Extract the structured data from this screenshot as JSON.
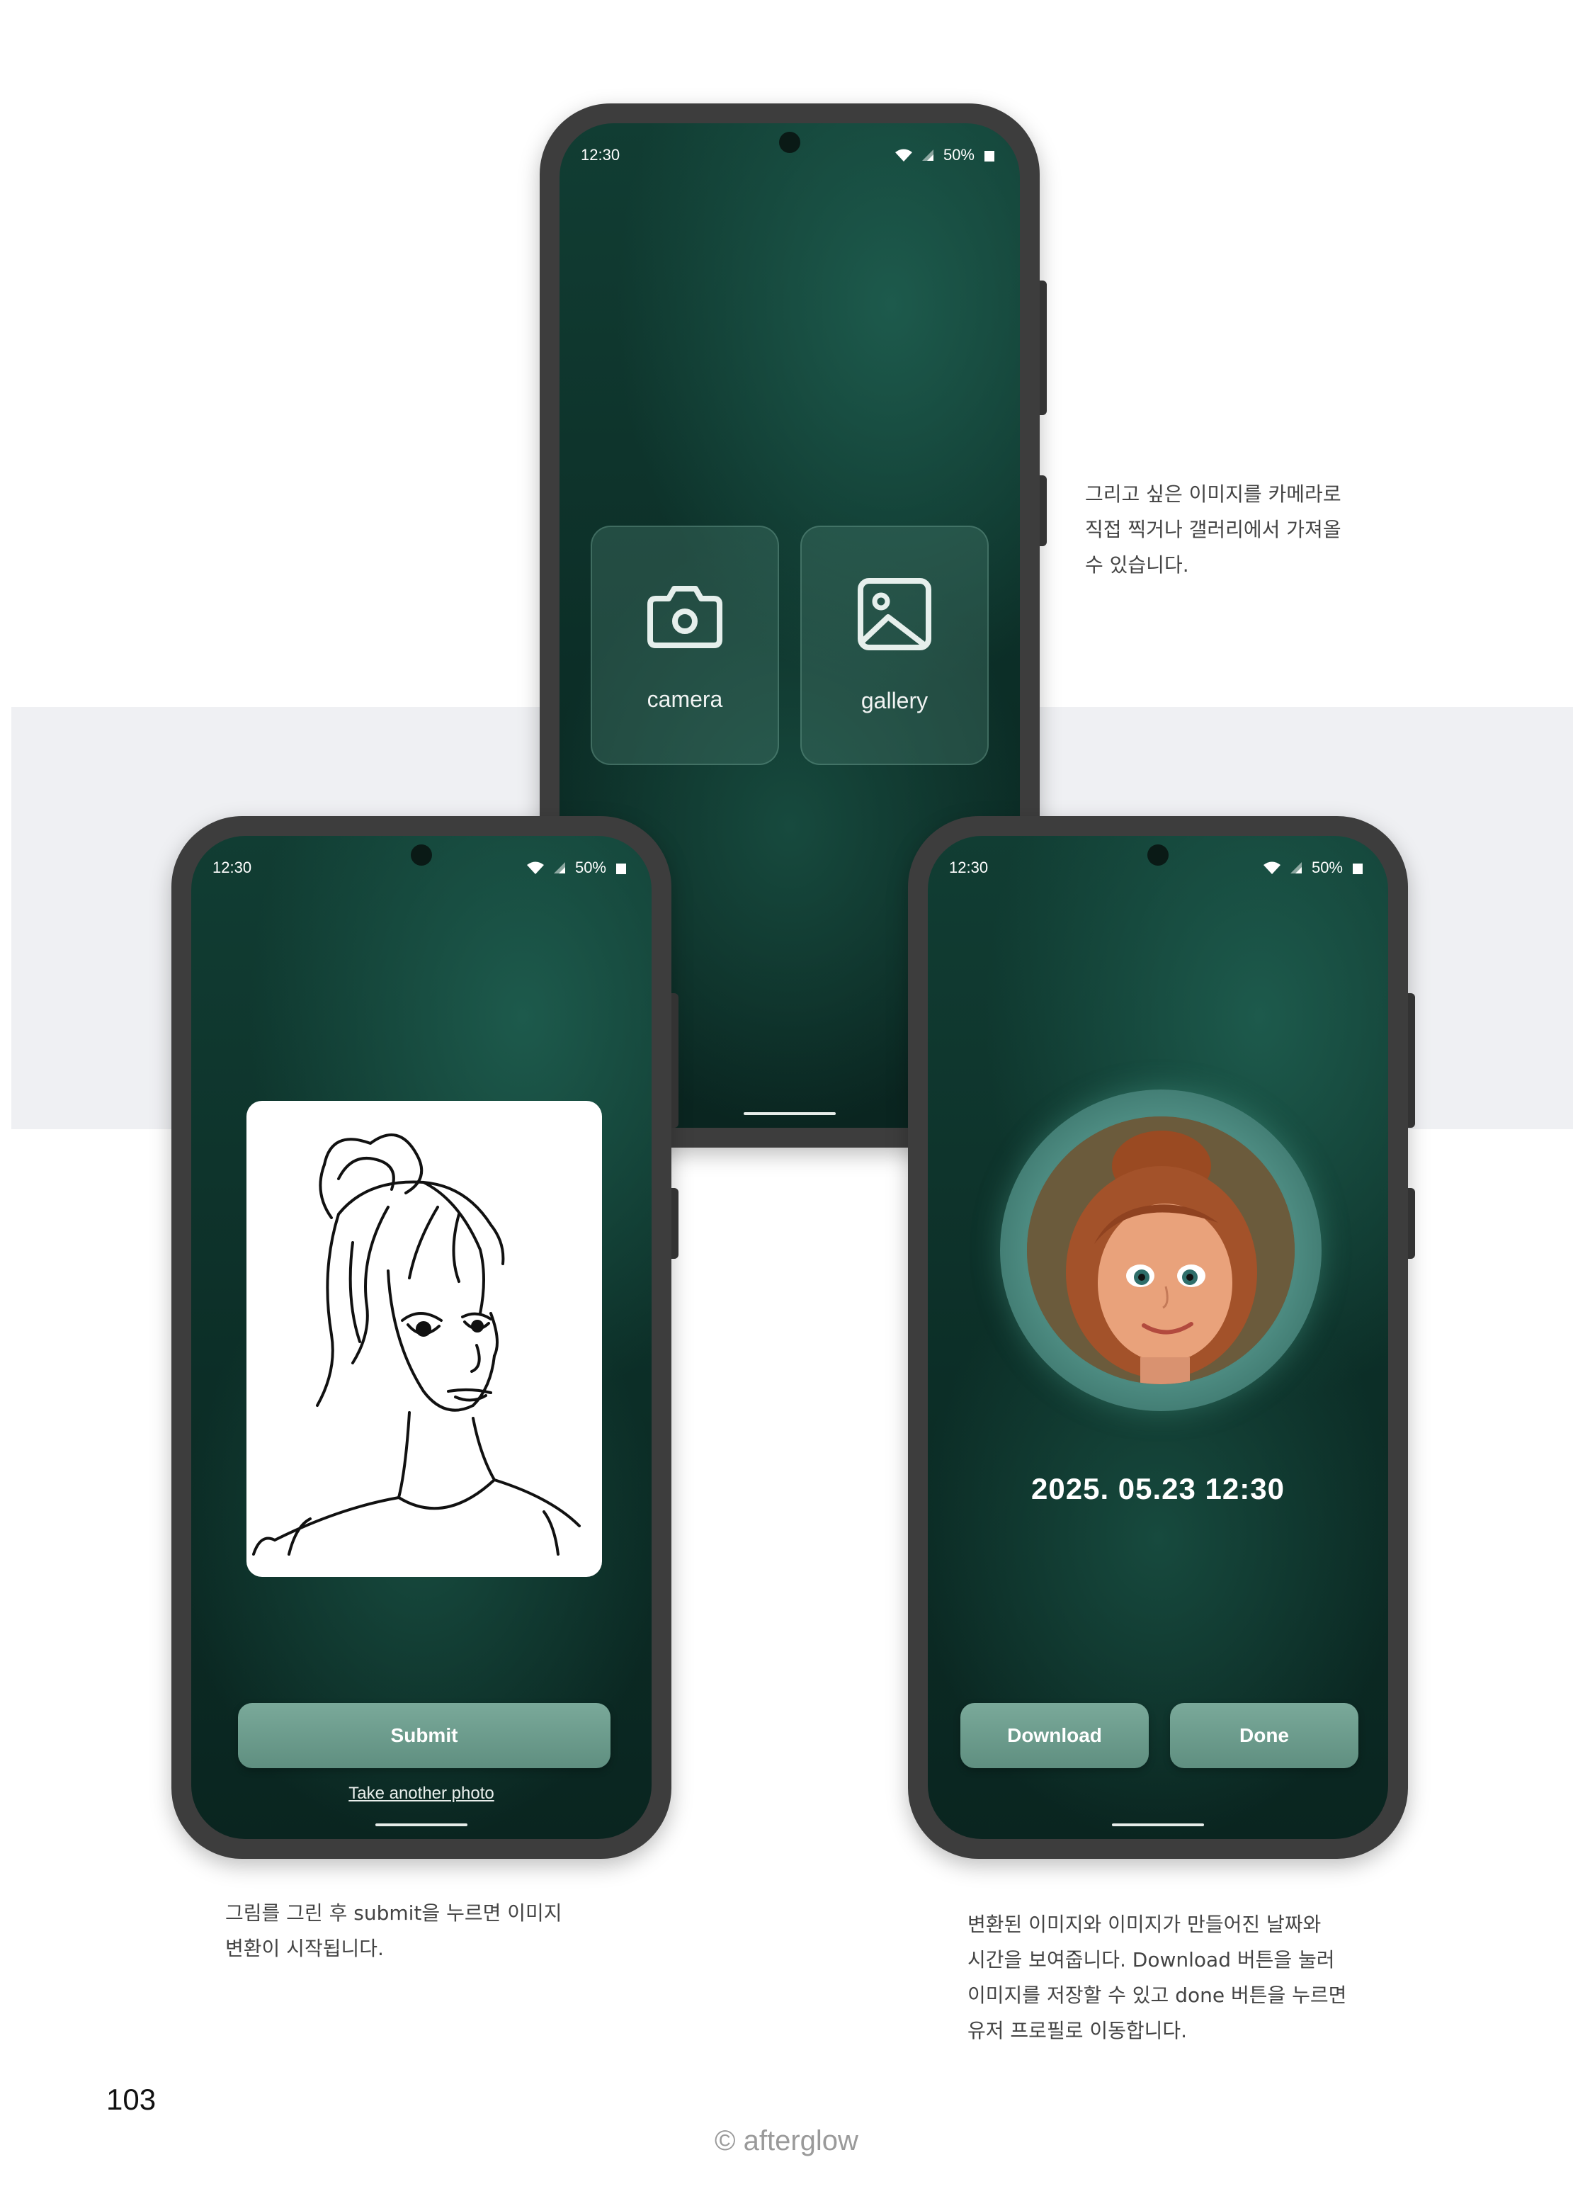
{
  "status_bar": {
    "time": "12:30",
    "battery": "50%"
  },
  "phone_top": {
    "camera_label": "camera",
    "gallery_label": "gallery",
    "caption": [
      "그리고 싶은 이미지를 카메라로",
      "직접 찍거나 갤러리에서 가져올",
      "수 있습니다."
    ]
  },
  "phone_left": {
    "submit_label": "Submit",
    "retake_label": "Take another photo",
    "caption": [
      "그림를 그린 후 submit을 누르면 이미지",
      "변환이 시작됩니다."
    ]
  },
  "phone_right": {
    "datetime": "2025. 05.23  12:30",
    "download_label": "Download",
    "done_label": "Done",
    "caption": [
      "변환된 이미지와 이미지가 만들어진 날짜와",
      "시간을 보여줍니다. Download 버튼을 눌러",
      "이미지를 저장할 수 있고 done 버튼을 누르면",
      "유저 프로필로 이동합니다."
    ]
  },
  "page_number": "103",
  "footer": "© afterglow",
  "icons": [
    "camera-icon",
    "gallery-icon",
    "wifi-icon",
    "signal-icon",
    "battery-icon"
  ],
  "colors": {
    "screen_bg": "#0f3a31",
    "button": "#6d9c8d",
    "band": "#eff0f3"
  }
}
